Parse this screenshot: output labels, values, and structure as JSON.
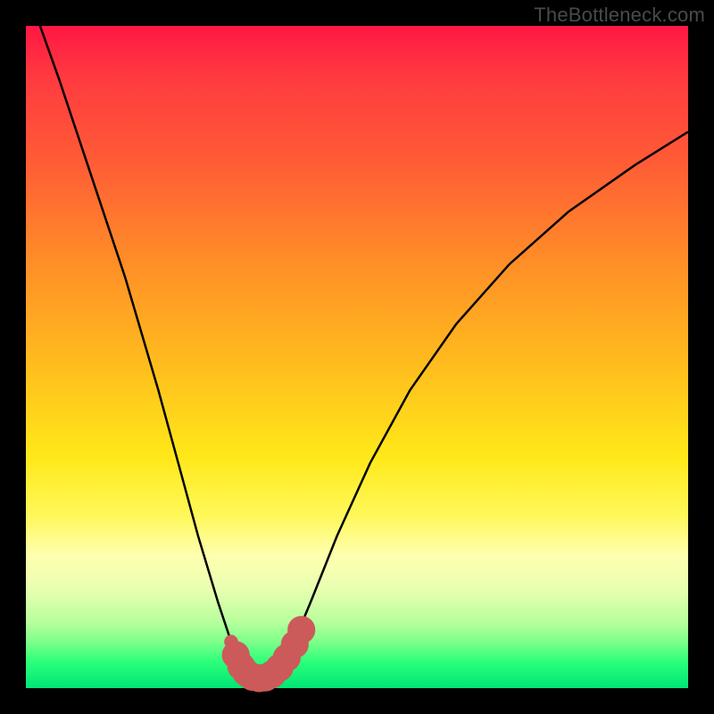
{
  "watermark": "TheBottleneck.com",
  "colors": {
    "frame_bg": "#000000",
    "curve_stroke": "#000000",
    "marker_stroke": "#cc5a5a",
    "marker_fill": "#cc5a5a"
  },
  "chart_data": {
    "type": "line",
    "title": "",
    "xlabel": "",
    "ylabel": "",
    "xlim": [
      0,
      100
    ],
    "ylim": [
      0,
      100
    ],
    "series": [
      {
        "name": "bottleneck-curve",
        "x": [
          0,
          5,
          10,
          15,
          20,
          23,
          26,
          29,
          31,
          33,
          34.5,
          36,
          38,
          40.5,
          43,
          47,
          52,
          58,
          65,
          73,
          82,
          92,
          100
        ],
        "y": [
          106,
          92,
          77,
          62,
          45,
          34,
          23,
          13,
          7,
          3,
          1.5,
          1.5,
          3,
          7,
          13,
          23,
          34,
          45,
          55,
          64,
          72,
          79,
          84
        ]
      }
    ],
    "markers": {
      "name": "highlighted-range",
      "points": [
        {
          "x": 31.0,
          "y": 7.0,
          "r": 1.0
        },
        {
          "x": 31.7,
          "y": 5.0,
          "r": 2.0
        },
        {
          "x": 32.5,
          "y": 3.3,
          "r": 2.0
        },
        {
          "x": 33.3,
          "y": 2.3,
          "r": 2.0
        },
        {
          "x": 34.2,
          "y": 1.7,
          "r": 2.0
        },
        {
          "x": 35.2,
          "y": 1.5,
          "r": 2.0
        },
        {
          "x": 36.2,
          "y": 1.6,
          "r": 2.0
        },
        {
          "x": 37.2,
          "y": 2.1,
          "r": 2.0
        },
        {
          "x": 38.3,
          "y": 3.1,
          "r": 2.0
        },
        {
          "x": 39.4,
          "y": 4.6,
          "r": 2.0
        },
        {
          "x": 40.6,
          "y": 6.6,
          "r": 2.0
        },
        {
          "x": 41.6,
          "y": 8.8,
          "r": 2.0
        }
      ]
    }
  }
}
